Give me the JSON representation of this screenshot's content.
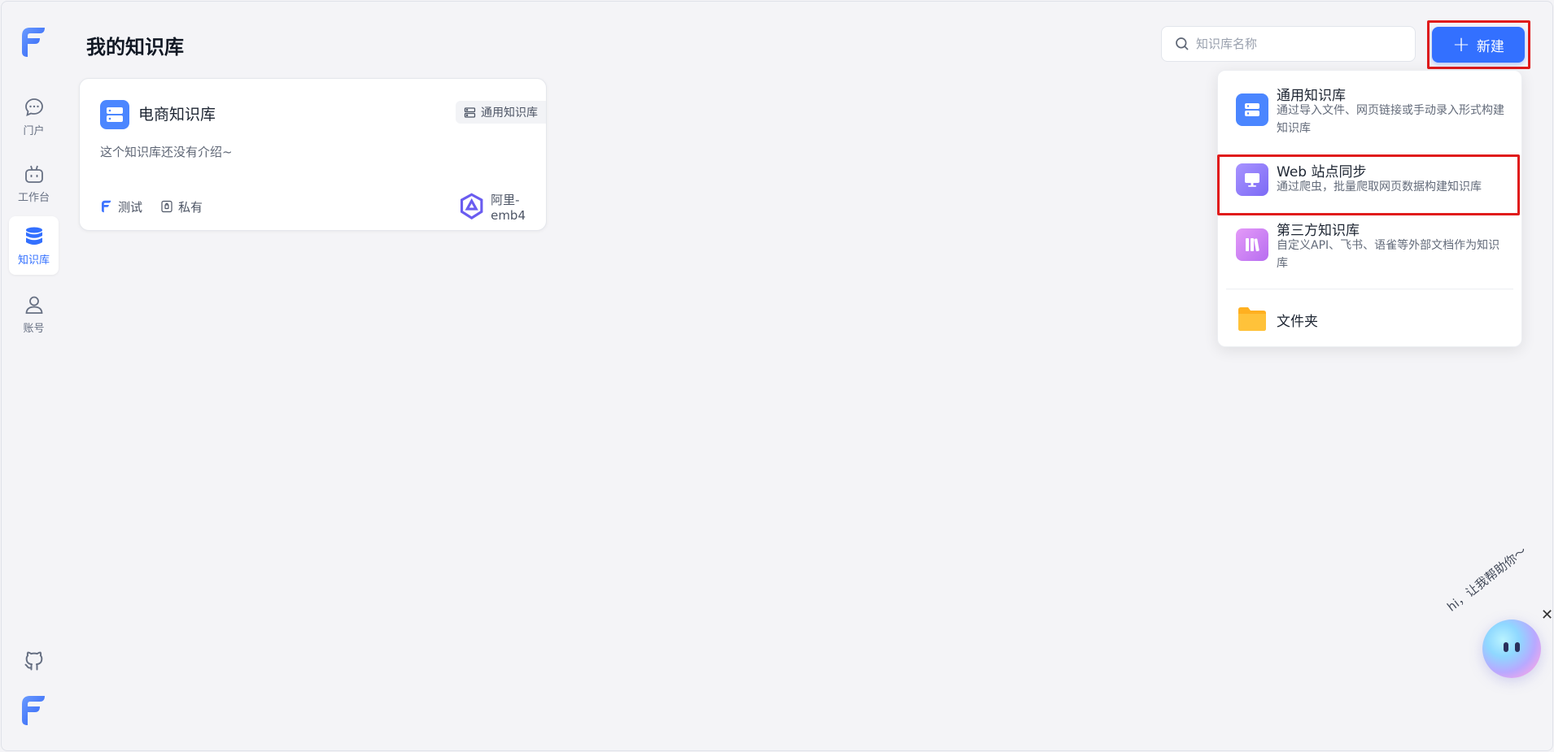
{
  "sidebar": {
    "items": [
      {
        "label": "门户",
        "icon": "chat-bubble-icon"
      },
      {
        "label": "工作台",
        "icon": "robot-icon"
      },
      {
        "label": "知识库",
        "icon": "database-icon",
        "active": true
      },
      {
        "label": "账号",
        "icon": "user-icon"
      }
    ]
  },
  "header": {
    "title": "我的知识库",
    "search_placeholder": "知识库名称",
    "new_button": "新建"
  },
  "card": {
    "name": "电商知识库",
    "type": "通用知识库",
    "intro": "这个知识库还没有介绍~",
    "owner": "测试",
    "permission": "私有",
    "model": "阿里-emb4"
  },
  "dropdown": {
    "items": [
      {
        "title": "通用知识库",
        "desc": "通过导入文件、网页链接或手动录入形式构建知识库",
        "icon": "database-icon"
      },
      {
        "title": "Web 站点同步",
        "desc": "通过爬虫，批量爬取网页数据构建知识库",
        "icon": "monitor-icon"
      },
      {
        "title": "第三方知识库",
        "desc": "自定义API、飞书、语雀等外部文档作为知识库",
        "icon": "books-icon"
      },
      {
        "title": "文件夹",
        "icon": "folder-icon"
      }
    ]
  },
  "assistant": {
    "greeting": "hi，让我帮助你～",
    "close": "✕"
  },
  "colors": {
    "accent": "#3370ff",
    "highlight": "#e01b1b",
    "background": "#f4f4f7"
  }
}
